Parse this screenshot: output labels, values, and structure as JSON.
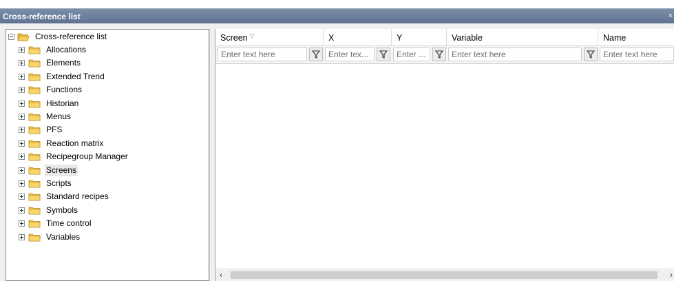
{
  "window": {
    "title": "Cross-reference list",
    "close_glyph": "×"
  },
  "tree": {
    "root_label": "Cross-reference list",
    "items": [
      {
        "label": "Allocations"
      },
      {
        "label": "Elements"
      },
      {
        "label": "Extended Trend"
      },
      {
        "label": "Functions"
      },
      {
        "label": "Historian"
      },
      {
        "label": "Menus"
      },
      {
        "label": "PFS"
      },
      {
        "label": "Reaction matrix"
      },
      {
        "label": "Recipegroup Manager"
      },
      {
        "label": "Screens"
      },
      {
        "label": "Scripts"
      },
      {
        "label": "Standard recipes"
      },
      {
        "label": "Symbols"
      },
      {
        "label": "Time control"
      },
      {
        "label": "Variables"
      }
    ],
    "selected": "Screens"
  },
  "grid": {
    "columns": [
      {
        "label": "Screen",
        "sort_glyph": "▽",
        "filter_placeholder": "Enter text here"
      },
      {
        "label": "X",
        "filter_placeholder": "Enter tex..."
      },
      {
        "label": "Y",
        "filter_placeholder": "Enter ..."
      },
      {
        "label": "Variable",
        "filter_placeholder": "Enter text here"
      },
      {
        "label": "Name",
        "filter_placeholder": "Enter text here"
      }
    ],
    "scroll_left_glyph": "‹",
    "scroll_right_glyph": "›"
  },
  "colors": {
    "titlebar": "#5f7392",
    "folder": "#f5c24a",
    "panel_bg": "#f0f0f0"
  }
}
